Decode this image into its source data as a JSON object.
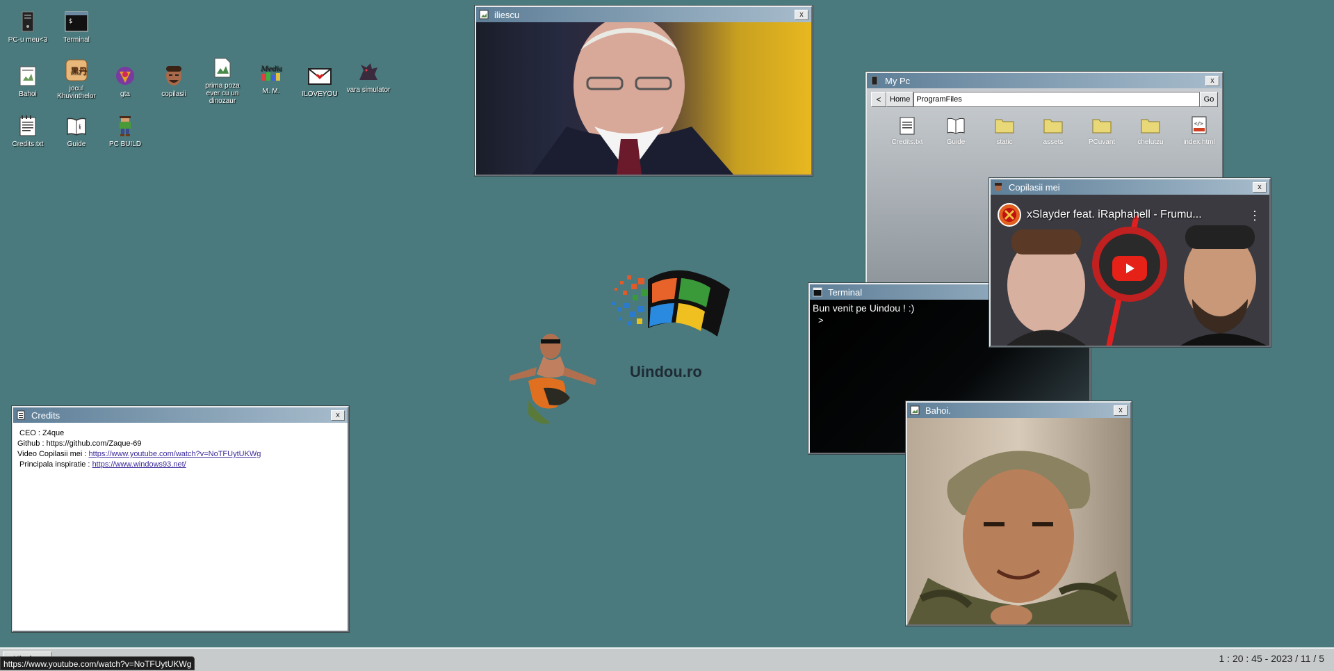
{
  "desktop": {
    "icons": [
      {
        "label": "PC-u meu<3",
        "icon": "computer-tower-icon"
      },
      {
        "label": "Terminal",
        "icon": "terminal-icon"
      },
      {
        "label": "Bahoi",
        "icon": "notepad-icon"
      },
      {
        "label": "jocul Khuvinthelor",
        "icon": "game-icon"
      },
      {
        "label": "gta",
        "icon": "gta-icon"
      },
      {
        "label": "copilasii",
        "icon": "face-icon"
      },
      {
        "label": "prima poza ever cu un dinozaur",
        "icon": "image-file-icon"
      },
      {
        "label": "M. M.",
        "icon": "media-player-icon"
      },
      {
        "label": "ILOVEYOU",
        "icon": "love-letter-icon"
      },
      {
        "label": "vara simulator",
        "icon": "dragon-icon"
      },
      {
        "label": "Credits.txt",
        "icon": "notepad-icon"
      },
      {
        "label": "Guide",
        "icon": "book-icon"
      },
      {
        "label": "PC BUILD",
        "icon": "pixel-character-icon"
      }
    ],
    "logo_text": "Uindou.ro"
  },
  "windows": {
    "iliescu": {
      "title": "iliescu",
      "close": "x"
    },
    "mypc": {
      "title": "My Pc",
      "close": "x",
      "back": "<",
      "home": "Home",
      "path": "ProgramFiles",
      "go": "Go",
      "files": [
        "Credits.txt",
        "Guide",
        "static",
        "assets",
        "PCuvant",
        "chelutzu",
        "index.html"
      ]
    },
    "copilasii": {
      "title": "Copilasii mei",
      "close": "x",
      "video_title": "xSlayder feat. iRaphahell - Frumu...",
      "menu": "⋮"
    },
    "terminal": {
      "title": "Terminal",
      "welcome": "Bun venit pe Uindou ! :)",
      "prompt": ">"
    },
    "bahoi": {
      "title": "Bahoi.",
      "close": "x"
    },
    "credits": {
      "title": "Credits",
      "close": "x",
      "ceo_label": "CEO : Z4que",
      "github_label": "Github : https://github.com/Zaque-69",
      "video_label": "Video Copilasii mei : ",
      "video_link": "https://www.youtube.com/watch?v=NoTFUytUKWg",
      "inspiration_label": "Principala inspiratie : ",
      "inspiration_link": "https://www.windows93.net/"
    }
  },
  "taskbar": {
    "start_label": "Uindou",
    "status_url": "https://www.youtube.com/watch?v=NoTFUytUKWg",
    "clock": "1 : 20 : 45 - 2023 / 11 / 5"
  },
  "colors": {
    "desktop": "#4a7a7d",
    "title_gradient_start": "#5e7f98",
    "title_gradient_end": "#a7bccc",
    "link": "#3a2a9a"
  }
}
